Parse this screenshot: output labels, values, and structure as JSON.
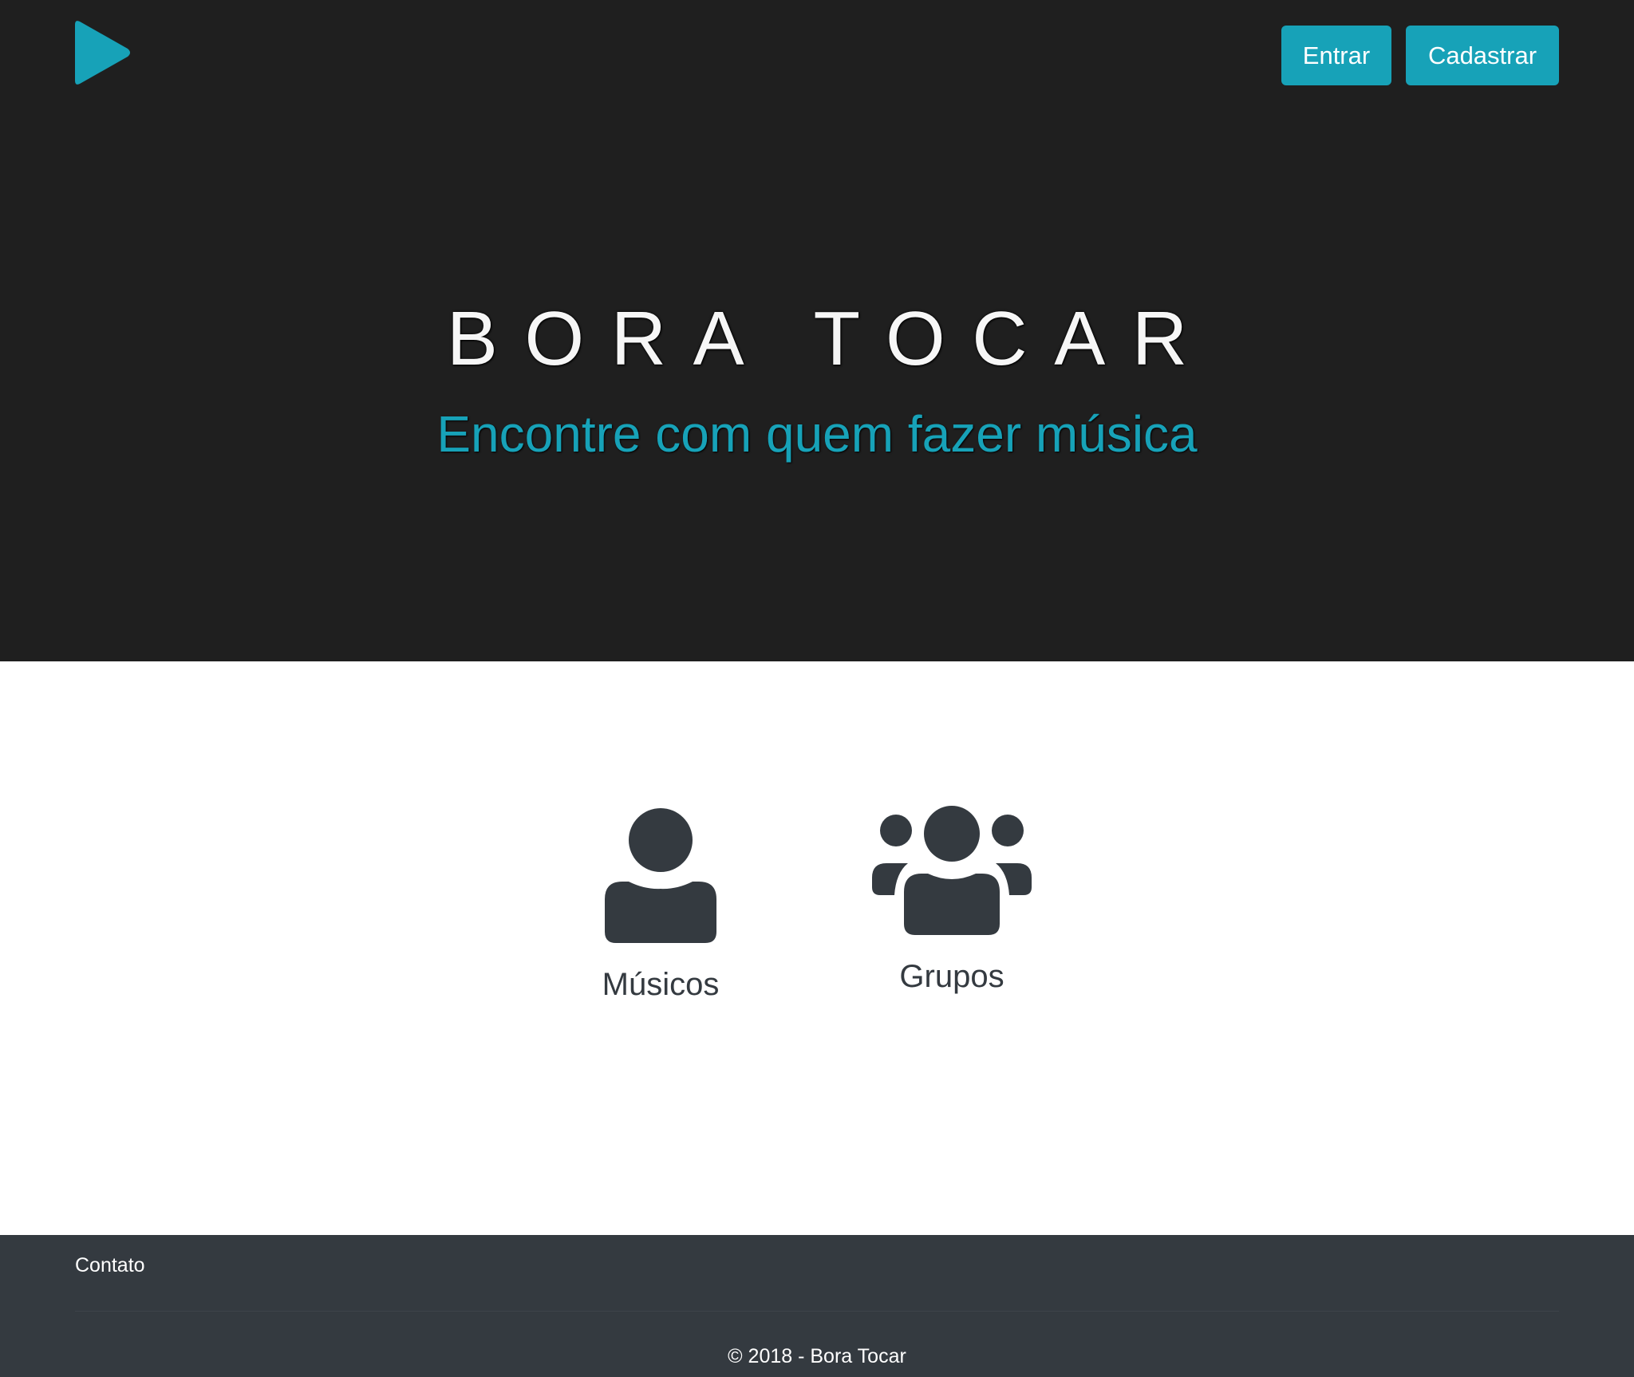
{
  "header": {
    "logo_icon": "play-icon",
    "login_label": "Entrar",
    "signup_label": "Cadastrar"
  },
  "hero": {
    "title": "BORA TOCAR",
    "subtitle": "Encontre com quem fazer música"
  },
  "features": [
    {
      "icon": "user-icon",
      "label": "Músicos"
    },
    {
      "icon": "users-icon",
      "label": "Grupos"
    }
  ],
  "footer": {
    "contact_label": "Contato",
    "copyright": "© 2018 - Bora Tocar"
  },
  "colors": {
    "accent": "#17a2b8",
    "hero_background": "#1f1f1f",
    "footer_background": "#343a40",
    "icon_color": "#343a40"
  }
}
